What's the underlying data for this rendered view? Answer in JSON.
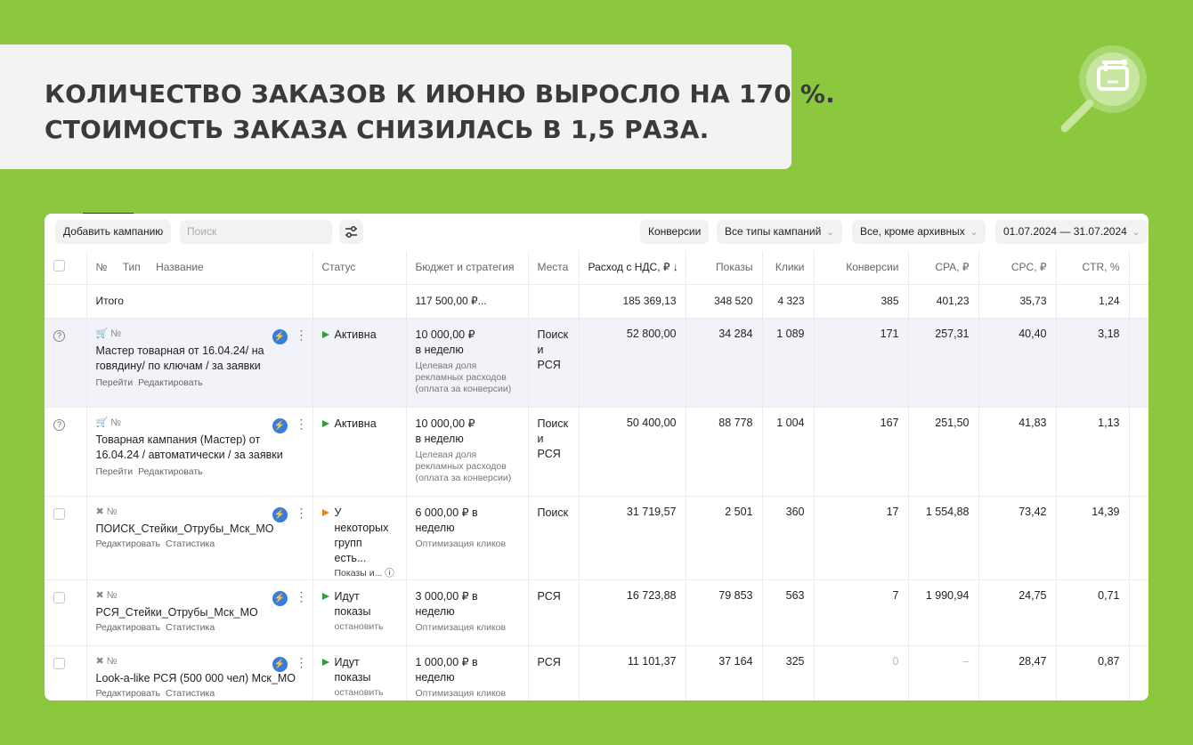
{
  "banner": {
    "line1": "КОЛИЧЕСТВО ЗАКАЗОВ К ИЮНЮ ВЫРОСЛО НА 170 %.",
    "line2": "СТОИМОСТЬ ЗАКАЗА СНИЗИЛАСЬ В 1,5 РАЗА."
  },
  "colors": {
    "background": "#8cc83e",
    "banner": "#f3f3f3",
    "accent_blue": "#3a7bdc",
    "status_green": "#2d9e3a",
    "status_orange": "#f08020"
  },
  "toolbar": {
    "add_campaign": "Добавить кампанию",
    "search_placeholder": "Поиск",
    "conversions": "Конверсии",
    "campaign_types": "Все типы кампаний",
    "archive_filter": "Все, кроме архивных",
    "date_range": "01.07.2024 — 31.07.2024"
  },
  "columns": {
    "num": "№",
    "type": "Тип",
    "name": "Название",
    "status": "Статус",
    "budget": "Бюджет и стратегия",
    "places": "Места",
    "spend": "Расход с НДС, ₽ ↓",
    "impressions": "Показы",
    "clicks": "Клики",
    "conversions": "Конверсии",
    "cpa": "CPA, ₽",
    "cpc": "CPC, ₽",
    "ctr": "CTR, %"
  },
  "total": {
    "label": "Итого",
    "budget": "117 500,00 ₽...",
    "spend": "185 369,13",
    "impressions": "348 520",
    "clicks": "4 323",
    "conversions": "385",
    "cpa": "401,23",
    "cpc": "35,73",
    "ctr": "1,24"
  },
  "rows": [
    {
      "meta": "№",
      "name": "Мастер товарная от 16.04.24/ на говядину/ по ключам / за заявки",
      "link1": "Перейти",
      "link2": "Редактировать",
      "status": "Активна",
      "status_sub": "",
      "budget": "10 000,00 ₽",
      "budget2": "в неделю",
      "budget_sub": "Целевая доля рекламных расходов (оплата за конверсии)",
      "places": "Поиск и РСЯ",
      "spend": "52 800,00",
      "impressions": "34 284",
      "clicks": "1 089",
      "conversions": "171",
      "cpa": "257,31",
      "cpc": "40,40",
      "ctr": "3,18"
    },
    {
      "meta": "№",
      "name": "Товарная кампания (Мастер) от 16.04.24 / автоматически / за заявки",
      "link1": "Перейти",
      "link2": "Редактировать",
      "status": "Активна",
      "status_sub": "",
      "budget": "10 000,00 ₽",
      "budget2": "в неделю",
      "budget_sub": "Целевая доля рекламных расходов (оплата за конверсии)",
      "places": "Поиск и РСЯ",
      "spend": "50 400,00",
      "impressions": "88 778",
      "clicks": "1 004",
      "conversions": "167",
      "cpa": "251,50",
      "cpc": "41,83",
      "ctr": "1,13"
    },
    {
      "meta": "№",
      "name": "ПОИСК_Стейки_Отрубы_Мск_МО",
      "link1": "Редактировать",
      "link2": "Статистика",
      "status": "У некоторых групп есть...",
      "status_sub": "Показы и...",
      "budget": "6 000,00 ₽ в неделю",
      "budget2": "",
      "budget_sub": "Оптимизация кликов",
      "places": "Поиск",
      "spend": "31 719,57",
      "impressions": "2 501",
      "clicks": "360",
      "conversions": "17",
      "cpa": "1 554,88",
      "cpc": "73,42",
      "ctr": "14,39"
    },
    {
      "meta": "№",
      "name": "РСЯ_Стейки_Отрубы_Мск_МО",
      "link1": "Редактировать",
      "link2": "Статистика",
      "status": "Идут показы",
      "status_sub": "остановить",
      "budget": "3 000,00 ₽ в неделю",
      "budget2": "",
      "budget_sub": "Оптимизация кликов",
      "places": "РСЯ",
      "spend": "16 723,88",
      "impressions": "79 853",
      "clicks": "563",
      "conversions": "7",
      "cpa": "1 990,94",
      "cpc": "24,75",
      "ctr": "0,71"
    },
    {
      "meta": "№",
      "name": "Look-a-like РСЯ (500 000 чел) Мск_МО",
      "link1": "Редактировать",
      "link2": "Статистика",
      "status": "Идут показы",
      "status_sub": "остановить",
      "budget": "1 000,00 ₽ в неделю",
      "budget2": "",
      "budget_sub": "Оптимизация кликов",
      "places": "РСЯ",
      "spend": "11 101,37",
      "impressions": "37 164",
      "clicks": "325",
      "conversions": "0",
      "cpa": "–",
      "cpc": "28,47",
      "ctr": "0,87"
    }
  ]
}
